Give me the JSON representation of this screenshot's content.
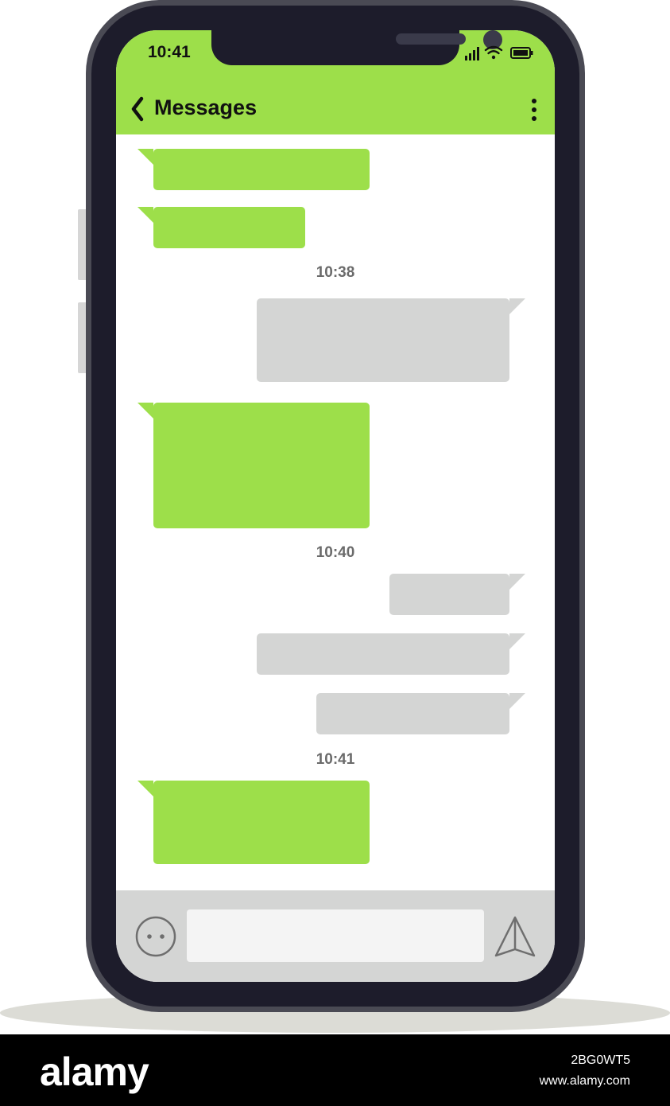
{
  "status_bar": {
    "time": "10:41"
  },
  "header": {
    "title": "Messages"
  },
  "conversation": {
    "timestamps": [
      "10:38",
      "10:40",
      "10:41"
    ]
  },
  "compose": {
    "input_value": "",
    "input_placeholder": ""
  },
  "icons": {
    "back": "chevron-left-icon",
    "more": "more-vertical-icon",
    "emoji": "emoji-icon",
    "send": "send-icon",
    "signal": "signal-icon",
    "wifi": "wifi-icon",
    "battery": "battery-icon"
  },
  "colors": {
    "accent": "#9ddf4a",
    "outgoing_bubble": "#d4d5d4",
    "phone_body": "#1d1c2b",
    "phone_frame": "#4a4a54"
  },
  "watermark": {
    "brand": "alamy",
    "image_id": "2BG0WT5",
    "site": "www.alamy.com"
  }
}
